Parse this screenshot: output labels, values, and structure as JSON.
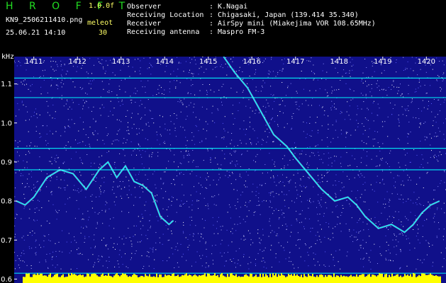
{
  "header": {
    "brand": "H R O F F T",
    "version": "1.0.0f",
    "filename": "KN9_2506211410.png",
    "station_code": "meleot",
    "datetime": "25.06.21 14:10",
    "count": "30"
  },
  "info": [
    {
      "label": "Observer",
      "value": ": K.Nagai"
    },
    {
      "label": "Receiving Location",
      "value": ": Chigasaki, Japan (139.414 35.340)"
    },
    {
      "label": "Receiver",
      "value": ": AirSpy mini (Miakejima VOR 108.65MHz)"
    },
    {
      "label": "Receiving antenna",
      "value": ": Maspro FM-3"
    }
  ],
  "colors": {
    "background": "#000000",
    "spectrum_bg": "#10108a",
    "axis_text": "#ffffff",
    "brand": "#22dd22",
    "accent": "#ffff66",
    "signal": "#00ffff",
    "band_bar": "#ffff00"
  },
  "chart_data": {
    "type": "heatmap",
    "xlabel": "",
    "ylabel": "kHz",
    "x_ticks": [
      "1411",
      "1412",
      "1413",
      "1414",
      "1415",
      "1416",
      "1417",
      "1418",
      "1419",
      "1420"
    ],
    "x_tick_values": [
      1411,
      1412,
      1413,
      1414,
      1415,
      1416,
      1417,
      1418,
      1419,
      1420
    ],
    "y_ticks": [
      "1.1",
      "1.0",
      "0.9",
      "0.8",
      "0.7",
      "0.6"
    ],
    "y_tick_values": [
      1.1,
      1.0,
      0.9,
      0.8,
      0.7,
      0.6
    ],
    "xlim": [
      1410.55,
      1420.45
    ],
    "ylim": [
      0.59,
      1.17
    ],
    "carrier_lines_khz": [
      1.115,
      1.065,
      0.935,
      0.88,
      0.615
    ],
    "echo_trace": [
      {
        "x": 1410.6,
        "y": 0.8
      },
      {
        "x": 1410.8,
        "y": 0.79
      },
      {
        "x": 1411.0,
        "y": 0.81
      },
      {
        "x": 1411.3,
        "y": 0.86
      },
      {
        "x": 1411.6,
        "y": 0.88
      },
      {
        "x": 1411.9,
        "y": 0.87
      },
      {
        "x": 1412.2,
        "y": 0.83
      },
      {
        "x": 1412.5,
        "y": 0.88
      },
      {
        "x": 1412.7,
        "y": 0.9
      },
      {
        "x": 1412.9,
        "y": 0.86
      },
      {
        "x": 1413.1,
        "y": 0.89
      },
      {
        "x": 1413.3,
        "y": 0.85
      },
      {
        "x": 1413.5,
        "y": 0.84
      },
      {
        "x": 1413.7,
        "y": 0.82
      },
      {
        "x": 1413.9,
        "y": 0.76
      },
      {
        "x": 1414.1,
        "y": 0.74
      },
      {
        "x": 1414.2,
        "y": 0.75
      }
    ],
    "meteor_trace": [
      {
        "x": 1415.35,
        "y": 1.17
      },
      {
        "x": 1415.6,
        "y": 1.13
      },
      {
        "x": 1415.9,
        "y": 1.09
      },
      {
        "x": 1416.2,
        "y": 1.03
      },
      {
        "x": 1416.5,
        "y": 0.97
      },
      {
        "x": 1416.8,
        "y": 0.94
      },
      {
        "x": 1417.0,
        "y": 0.91
      },
      {
        "x": 1417.3,
        "y": 0.87
      },
      {
        "x": 1417.6,
        "y": 0.83
      },
      {
        "x": 1417.9,
        "y": 0.8
      },
      {
        "x": 1418.2,
        "y": 0.81
      },
      {
        "x": 1418.4,
        "y": 0.79
      },
      {
        "x": 1418.6,
        "y": 0.76
      },
      {
        "x": 1418.9,
        "y": 0.73
      },
      {
        "x": 1419.2,
        "y": 0.74
      },
      {
        "x": 1419.5,
        "y": 0.72
      },
      {
        "x": 1419.7,
        "y": 0.74
      },
      {
        "x": 1419.9,
        "y": 0.77
      },
      {
        "x": 1420.1,
        "y": 0.79
      },
      {
        "x": 1420.3,
        "y": 0.8
      }
    ]
  }
}
